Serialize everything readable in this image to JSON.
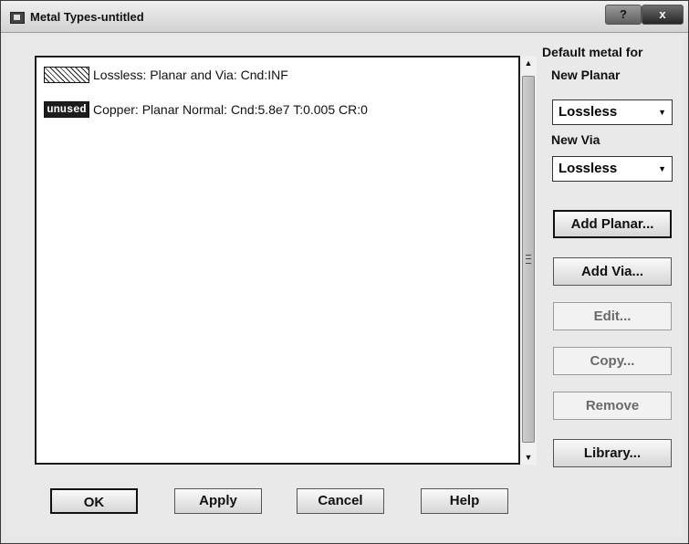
{
  "window": {
    "title": "Metal Types-untitled",
    "help_label": "?",
    "close_label": "x"
  },
  "metals": [
    {
      "label": "Lossless:  Planar and Via: Cnd:INF",
      "swatch": "hatch"
    },
    {
      "label": "Copper:  Planar Normal: Cnd:5.8e7 T:0.005 CR:0",
      "swatch": "unused",
      "badge": "unused"
    }
  ],
  "defaults": {
    "heading": "Default metal for",
    "planar_label": "New Planar",
    "planar_value": "Lossless",
    "via_label": "New Via",
    "via_value": "Lossless"
  },
  "side_buttons": {
    "add_planar": "Add Planar...",
    "add_via": "Add Via...",
    "edit": "Edit...",
    "copy": "Copy...",
    "remove": "Remove",
    "library": "Library..."
  },
  "bottom_buttons": {
    "ok": "OK",
    "apply": "Apply",
    "cancel": "Cancel",
    "help": "Help"
  }
}
